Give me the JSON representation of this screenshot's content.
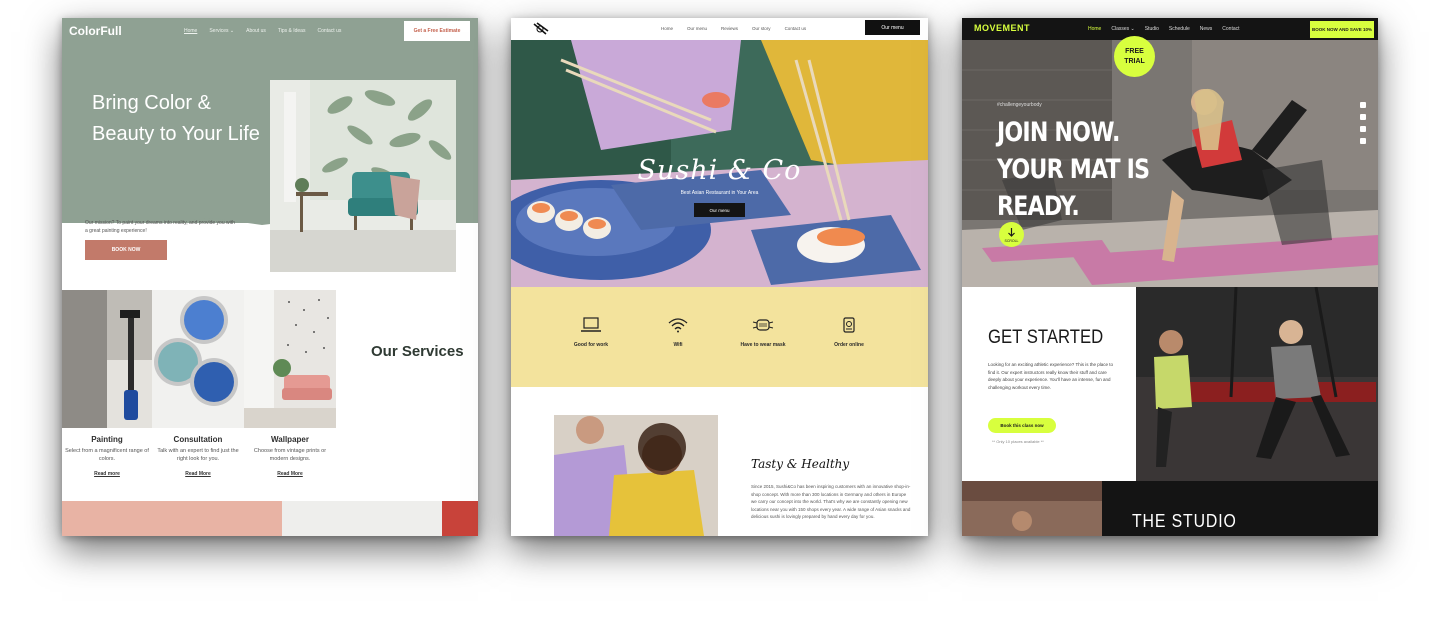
{
  "colorfull": {
    "logo": "ColorFull",
    "nav": [
      "Home",
      "Services ⌄",
      "About us",
      "Tips & Ideas",
      "Contact us"
    ],
    "cta": "Get a Free Estimate",
    "hero_title": "Bring Color & Beauty to Your Life",
    "mission": "Our mission? To paint your dreams into reality, and provide you with a great painting experience!",
    "book_button": "BOOK NOW",
    "services_title": "Our Services",
    "services": [
      {
        "title": "Painting",
        "desc": "Select from a magnificent range of colors.",
        "link": "Read more"
      },
      {
        "title": "Consultation",
        "desc": "Talk with an expert to find just the right look for you.",
        "link": "Read More"
      },
      {
        "title": "Wallpaper",
        "desc": "Choose from vintage prints or modern designs.",
        "link": "Read More"
      }
    ],
    "colors": {
      "hero": "#8fa193",
      "accent": "#c27a6a"
    }
  },
  "sushi": {
    "nav": [
      "Home",
      "Our menu",
      "Reviews",
      "Our story",
      "Contact us"
    ],
    "nav_button": "Our menu",
    "hero_title": "Sushi & Co",
    "hero_subtitle": "Best Asian Restaurant in Your Area",
    "hero_button": "Our menu",
    "features": [
      {
        "label": "Good for work",
        "icon": "laptop-icon"
      },
      {
        "label": "Wifi",
        "icon": "wifi-icon"
      },
      {
        "label": "Have to wear mask",
        "icon": "mask-icon"
      },
      {
        "label": "Order online",
        "icon": "order-online-icon"
      }
    ],
    "about_title": "Tasty & Healthy",
    "about_body": "Since 2015, Sushi&Co has been inspiring customers with an innovative shop-in-shop concept. With more than 300 locations in Germany and others in Europe we carry our concept into the world. That's why we are constantly opening new locations near you with 150 shops every year. A wide range of Asian snacks and delicious sushi is lovingly prepared by hand every day for you.",
    "colors": {
      "feature_band": "#f3e39d"
    }
  },
  "movement": {
    "logo": "MOVEMENT",
    "nav": [
      "Home",
      "Classes ⌄",
      "Studio",
      "Schedule",
      "News",
      "Contact"
    ],
    "cta": "BOOK NOW AND SAVE 10%",
    "hashtag": "#challengeyourbody",
    "hero_title": "JOIN NOW. YOUR MAT IS READY.",
    "scroll_label": "SCROLL",
    "started_title": "GET STARTED",
    "started_body": "Looking for an exciting athletic experience? This is the place to find it. Our expert instructors really know their stuff and care deeply about your experience. You'll have an intense, fun and challenging workout every time.",
    "book_button": "Book this class now",
    "spots_left": "** Only 10 places available **",
    "trial_badge": "FREE TRIAL",
    "studio_title": "THE STUDIO",
    "colors": {
      "accent": "#d8ff3e"
    }
  }
}
